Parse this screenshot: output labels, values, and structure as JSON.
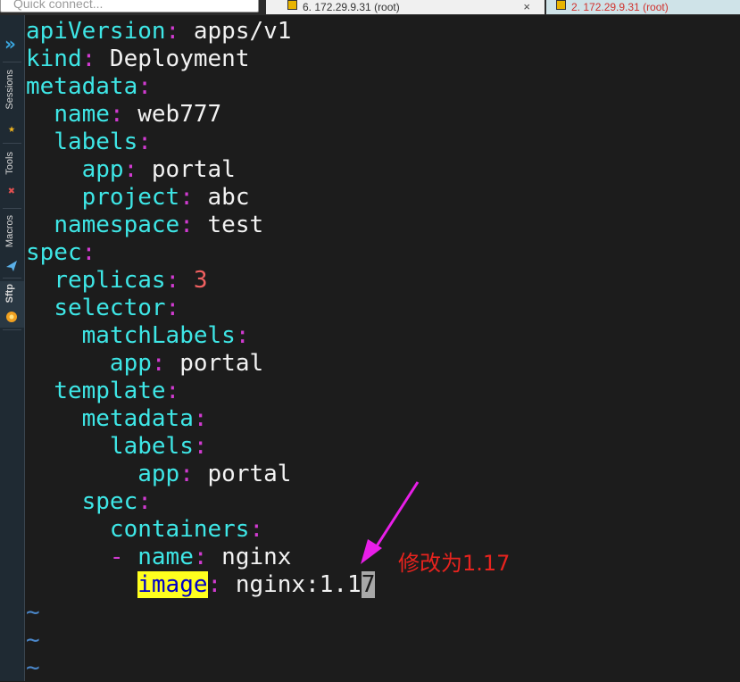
{
  "top_bar": {
    "quick_connect_placeholder": "Quick connect...",
    "tabs": [
      {
        "label": "6. 172.29.9.31 (root)",
        "active": true,
        "close": "×"
      },
      {
        "label": "2. 172.29.9.31 (root)",
        "active": false
      }
    ]
  },
  "sidebar": {
    "items": [
      {
        "label": "Sessions",
        "icon": "star-icon"
      },
      {
        "label": "Tools",
        "icon": "tools-icon"
      },
      {
        "label": "Macros",
        "icon": "paper-plane-icon"
      },
      {
        "label": "Sftp",
        "icon": "sftp-icon"
      }
    ]
  },
  "editor": {
    "lines": [
      [
        {
          "t": "apiVersion",
          "c": "k"
        },
        {
          "t": ":",
          "c": "p"
        },
        {
          "t": " apps/v1",
          "c": "v"
        }
      ],
      [
        {
          "t": "kind",
          "c": "k"
        },
        {
          "t": ":",
          "c": "p"
        },
        {
          "t": " Deployment",
          "c": "v"
        }
      ],
      [
        {
          "t": "metadata",
          "c": "k"
        },
        {
          "t": ":",
          "c": "p"
        }
      ],
      [
        {
          "t": "  ",
          "c": "v"
        },
        {
          "t": "name",
          "c": "k"
        },
        {
          "t": ":",
          "c": "p"
        },
        {
          "t": " web777",
          "c": "v"
        }
      ],
      [
        {
          "t": "  ",
          "c": "v"
        },
        {
          "t": "labels",
          "c": "k"
        },
        {
          "t": ":",
          "c": "p"
        }
      ],
      [
        {
          "t": "    ",
          "c": "v"
        },
        {
          "t": "app",
          "c": "k"
        },
        {
          "t": ":",
          "c": "p"
        },
        {
          "t": " portal",
          "c": "v"
        }
      ],
      [
        {
          "t": "    ",
          "c": "v"
        },
        {
          "t": "project",
          "c": "k"
        },
        {
          "t": ":",
          "c": "p"
        },
        {
          "t": " abc",
          "c": "v"
        }
      ],
      [
        {
          "t": "  ",
          "c": "v"
        },
        {
          "t": "namespace",
          "c": "k"
        },
        {
          "t": ":",
          "c": "p"
        },
        {
          "t": " test",
          "c": "v"
        }
      ],
      [
        {
          "t": "spec",
          "c": "k"
        },
        {
          "t": ":",
          "c": "p"
        }
      ],
      [
        {
          "t": "  ",
          "c": "v"
        },
        {
          "t": "replicas",
          "c": "k"
        },
        {
          "t": ":",
          "c": "p"
        },
        {
          "t": " ",
          "c": "v"
        },
        {
          "t": "3",
          "c": "n"
        }
      ],
      [
        {
          "t": "  ",
          "c": "v"
        },
        {
          "t": "selector",
          "c": "k"
        },
        {
          "t": ":",
          "c": "p"
        }
      ],
      [
        {
          "t": "    ",
          "c": "v"
        },
        {
          "t": "matchLabels",
          "c": "k"
        },
        {
          "t": ":",
          "c": "p"
        }
      ],
      [
        {
          "t": "      ",
          "c": "v"
        },
        {
          "t": "app",
          "c": "k"
        },
        {
          "t": ":",
          "c": "p"
        },
        {
          "t": " portal",
          "c": "v"
        }
      ],
      [
        {
          "t": "  ",
          "c": "v"
        },
        {
          "t": "template",
          "c": "k"
        },
        {
          "t": ":",
          "c": "p"
        }
      ],
      [
        {
          "t": "    ",
          "c": "v"
        },
        {
          "t": "metadata",
          "c": "k"
        },
        {
          "t": ":",
          "c": "p"
        }
      ],
      [
        {
          "t": "      ",
          "c": "v"
        },
        {
          "t": "labels",
          "c": "k"
        },
        {
          "t": ":",
          "c": "p"
        }
      ],
      [
        {
          "t": "        ",
          "c": "v"
        },
        {
          "t": "app",
          "c": "k"
        },
        {
          "t": ":",
          "c": "p"
        },
        {
          "t": " portal",
          "c": "v"
        }
      ],
      [
        {
          "t": "    ",
          "c": "v"
        },
        {
          "t": "spec",
          "c": "k"
        },
        {
          "t": ":",
          "c": "p"
        }
      ],
      [
        {
          "t": "      ",
          "c": "v"
        },
        {
          "t": "containers",
          "c": "k"
        },
        {
          "t": ":",
          "c": "p"
        }
      ],
      [
        {
          "t": "      ",
          "c": "v"
        },
        {
          "t": "-",
          "c": "p"
        },
        {
          "t": " ",
          "c": "v"
        },
        {
          "t": "name",
          "c": "k"
        },
        {
          "t": ":",
          "c": "p"
        },
        {
          "t": " nginx",
          "c": "v"
        }
      ],
      [
        {
          "t": "        ",
          "c": "v"
        },
        {
          "t": "image",
          "c": "hl"
        },
        {
          "t": ":",
          "c": "p"
        },
        {
          "t": " nginx:1.1",
          "c": "v"
        },
        {
          "t": "7",
          "c": "cur"
        }
      ],
      [
        {
          "t": "~",
          "c": "tilde"
        }
      ],
      [
        {
          "t": "~",
          "c": "tilde"
        }
      ],
      [
        {
          "t": "~",
          "c": "tilde"
        }
      ]
    ]
  },
  "annotation": {
    "text": "修改为1.17",
    "arrow_color": "#e81ee8",
    "text_color": "#e8231e"
  }
}
